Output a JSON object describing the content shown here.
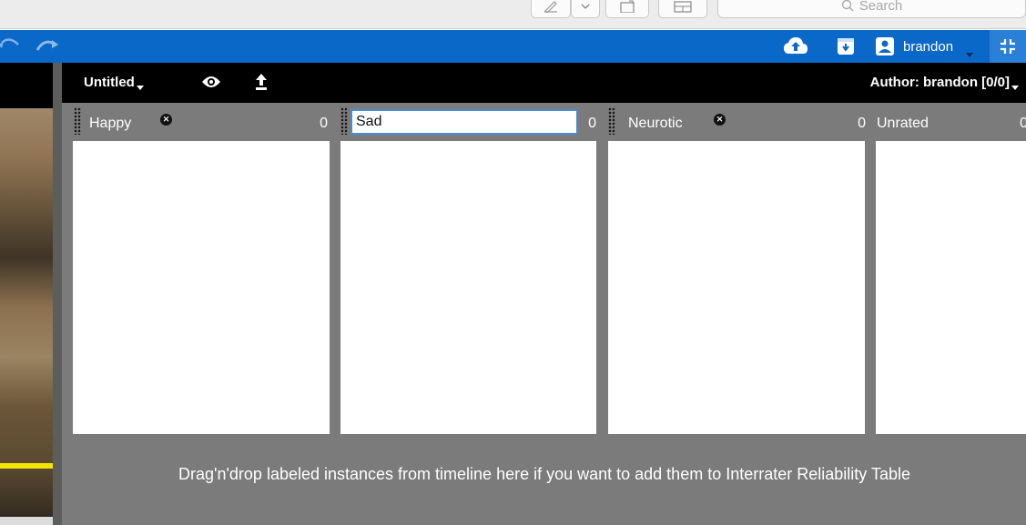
{
  "toolbar": {
    "search_placeholder": "Search"
  },
  "app_bar": {
    "username": "brandon",
    "accent": "#0a68c9"
  },
  "header": {
    "doc_title": "Untitled",
    "author": "Author: brandon [0/0]"
  },
  "columns": [
    {
      "label": "Happy",
      "count": "0",
      "removable": true
    },
    {
      "label": "Sad",
      "count": "0",
      "editing": true
    },
    {
      "label": "Neurotic",
      "count": "0",
      "removable": true
    },
    {
      "label": "Unrated",
      "count": "0"
    }
  ],
  "drop_hint": "Drag'n'drop labeled instances from timeline here if you want to add them to Interrater Reliability Table",
  "icons": [
    "pen-icon",
    "chevron-down-icon",
    "window-icon",
    "panel-icon",
    "search-icon",
    "undo-icon",
    "redo-icon",
    "cloud-upload-icon",
    "download-box-icon",
    "user-icon",
    "collapse-icon",
    "eye-icon",
    "upload-icon",
    "close-icon",
    "grip-icon"
  ]
}
